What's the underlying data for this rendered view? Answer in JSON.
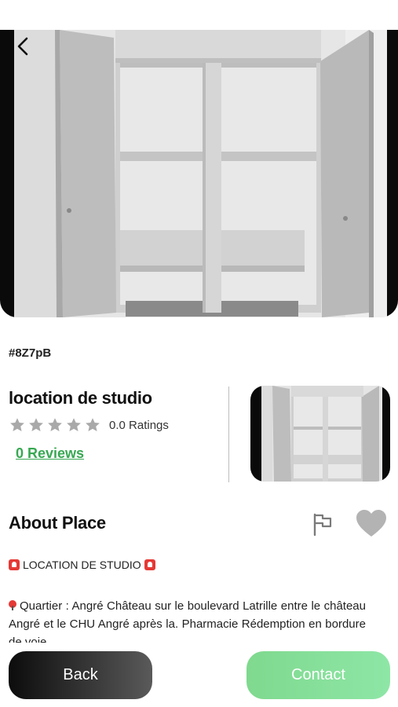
{
  "hero": {
    "image": "wardrobe-photo"
  },
  "listing": {
    "id": "#8Z7pB",
    "title": "location de studio",
    "rating_value": 0.0,
    "ratings_text": "0.0 Ratings",
    "reviews_text": "0 Reviews",
    "stars_total": 5,
    "stars_filled": 0
  },
  "about": {
    "title": "About Place",
    "headline": "LOCATION DE STUDIO",
    "paragraph": "Quartier : Angré Château sur le boulevard Latrille entre le château Angré et le CHU Angré après la. Pharmacie Rédemption en bordure de voie."
  },
  "actions": {
    "back_label": "Back",
    "contact_label": "Contact"
  },
  "colors": {
    "accent_green": "#37a852",
    "contact_button": "#8ee6a6",
    "back_button": "#111111",
    "star_gray": "#a9a9a9",
    "heart_gray": "#b3b3b3"
  },
  "icons": {
    "back": "chevron-left-icon",
    "report": "flag-icon",
    "favorite": "heart-icon",
    "rating": "star-icon",
    "siren": "siren-emoji-icon",
    "pin": "pin-emoji-icon"
  }
}
